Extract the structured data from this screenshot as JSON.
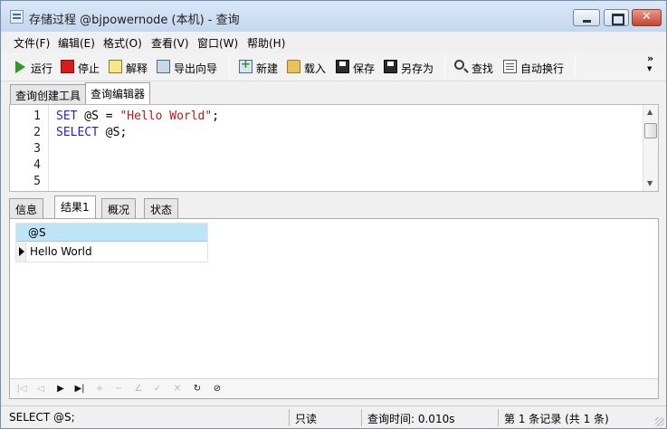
{
  "window": {
    "title": "存储过程 @bjpowernode (本机) - 查询"
  },
  "menu": {
    "items": [
      {
        "label": "文件(F)"
      },
      {
        "label": "编辑(E)"
      },
      {
        "label": "格式(O)"
      },
      {
        "label": "查看(V)"
      },
      {
        "label": "窗口(W)"
      },
      {
        "label": "帮助(H)"
      }
    ]
  },
  "toolbar": {
    "run": "运行",
    "stop": "停止",
    "explain": "解释",
    "export_wizard": "导出向导",
    "new": "新建",
    "load": "载入",
    "save": "保存",
    "save_as": "另存为",
    "find": "查找",
    "word_wrap": "自动换行",
    "overflow": "»"
  },
  "top_tabs": {
    "query_builder": "查询创建工具",
    "query_editor": "查询编辑器"
  },
  "editor": {
    "line_numbers": [
      "1",
      "2",
      "3",
      "4",
      "5"
    ],
    "line1": {
      "kw1": "SET",
      "var": " @S = ",
      "str": "\"Hello World\"",
      "end": ";"
    },
    "line2": {
      "kw1": "SELECT",
      "rest": " @S;"
    }
  },
  "result_tabs": {
    "info": "信息",
    "result1": "结果1",
    "profile": "概况",
    "status": "状态"
  },
  "results": {
    "columns": [
      "@S"
    ],
    "rows": [
      [
        "Hello World"
      ]
    ]
  },
  "status": {
    "sql": "SELECT @S;",
    "readonly": "只读",
    "query_time": "查询时间: 0.010s",
    "record": "第 1 条记录 (共 1 条)"
  }
}
